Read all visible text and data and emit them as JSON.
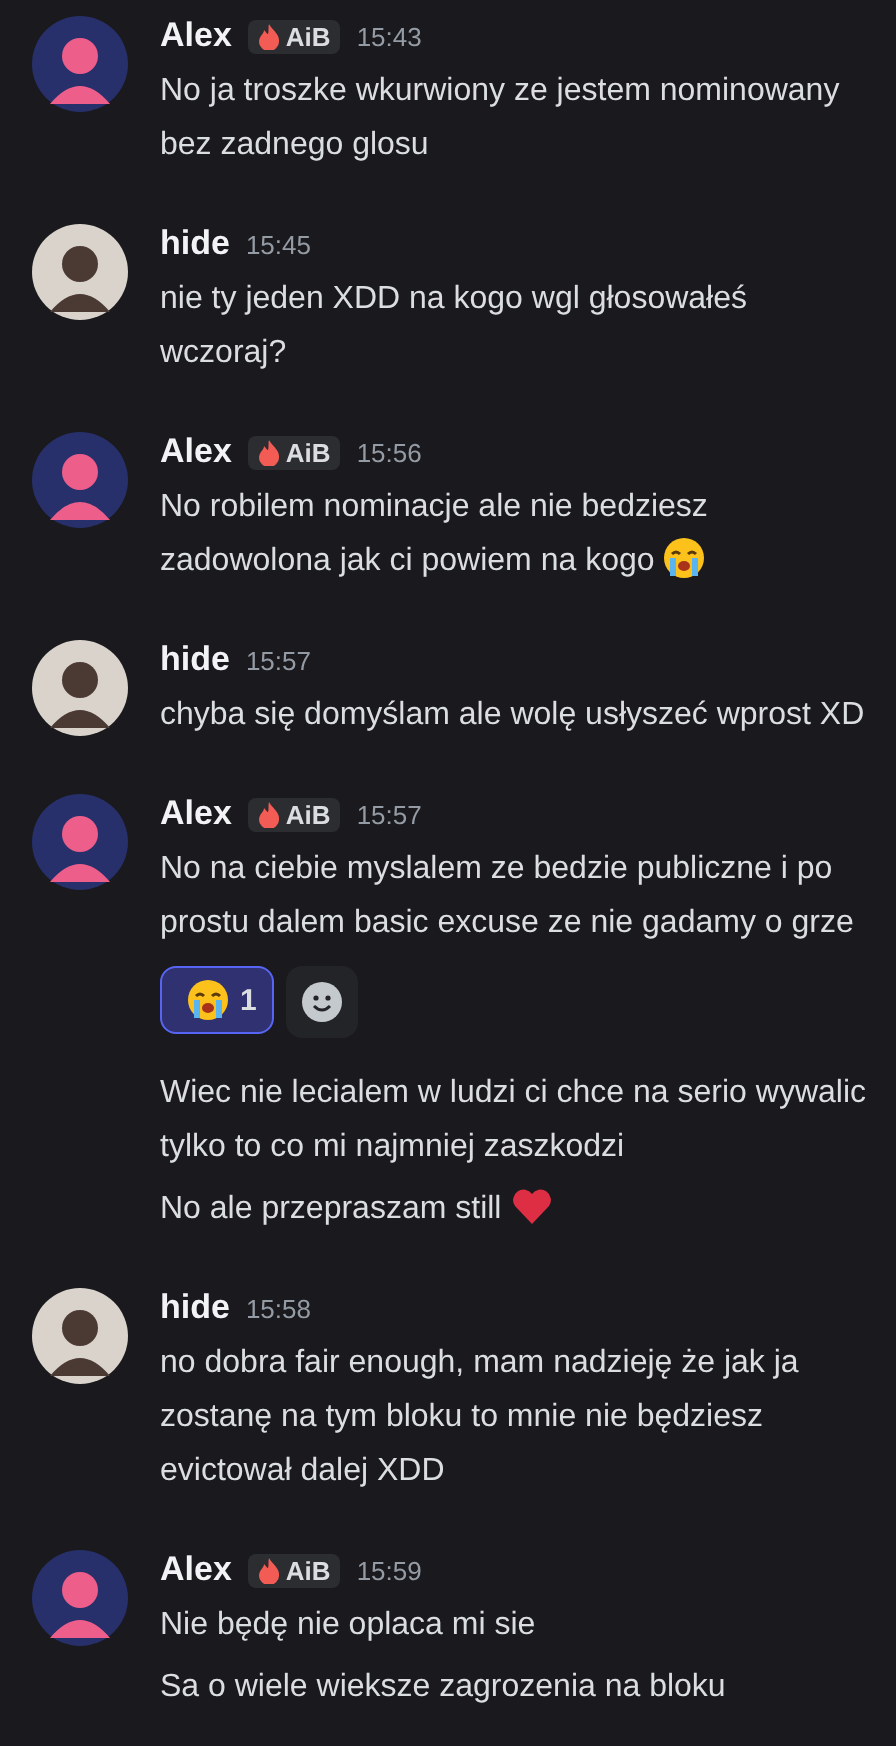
{
  "messages": [
    {
      "author": "Alex",
      "avatar": {
        "kind": "pink"
      },
      "tag": "AiB",
      "time": "15:43",
      "items": [
        {
          "kind": "text",
          "text": "No ja troszke wkurwiony ze jestem nominowany bez zadnego glosu"
        }
      ]
    },
    {
      "author": "hide",
      "avatar": {
        "kind": "sketch"
      },
      "time": "15:45",
      "items": [
        {
          "kind": "text",
          "text": "nie ty jeden XDD na kogo wgl głosowałeś wczoraj?"
        }
      ]
    },
    {
      "author": "Alex",
      "avatar": {
        "kind": "pink"
      },
      "tag": "AiB",
      "time": "15:56",
      "items": [
        {
          "kind": "text",
          "text": "No robilem nominacje ale nie bedziesz zadowolona jak ci powiem na kogo",
          "end_icon": {
            "kind": "crying"
          }
        }
      ]
    },
    {
      "author": "hide",
      "avatar": {
        "kind": "sketch"
      },
      "time": "15:57",
      "items": [
        {
          "kind": "text",
          "text": "chyba się domyślam ale wolę usłyszeć wprost XD"
        }
      ]
    },
    {
      "author": "Alex",
      "avatar": {
        "kind": "pink"
      },
      "tag": "AiB",
      "time": "15:57",
      "items": [
        {
          "kind": "text",
          "text": "No na ciebie myslalem ze bedzie publiczne i po prostu dalem basic excuse ze nie gadamy o grze"
        },
        {
          "kind": "reactions",
          "reactions": [
            {
              "icon": {
                "kind": "crying"
              },
              "count": "1",
              "selected": true
            }
          ]
        },
        {
          "kind": "text",
          "text": "Wiec nie lecialem w ludzi ci chce na serio wywalic tylko to co mi najmniej zaszkodzi"
        },
        {
          "kind": "text",
          "text": "No ale przepraszam still",
          "end_icon": {
            "kind": "heart"
          }
        }
      ]
    },
    {
      "author": "hide",
      "avatar": {
        "kind": "sketch"
      },
      "time": "15:58",
      "items": [
        {
          "kind": "text",
          "text": "no dobra fair enough, mam nadzieję że jak ja zostanę na tym bloku to mnie nie będziesz evictował dalej XDD"
        }
      ]
    },
    {
      "author": "Alex",
      "avatar": {
        "kind": "pink"
      },
      "tag": "AiB",
      "time": "15:59",
      "items": [
        {
          "kind": "text",
          "text": "Nie będę nie oplaca mi sie"
        },
        {
          "kind": "text",
          "text": "Sa o wiele wieksze zagrozenia na bloku"
        }
      ]
    }
  ]
}
